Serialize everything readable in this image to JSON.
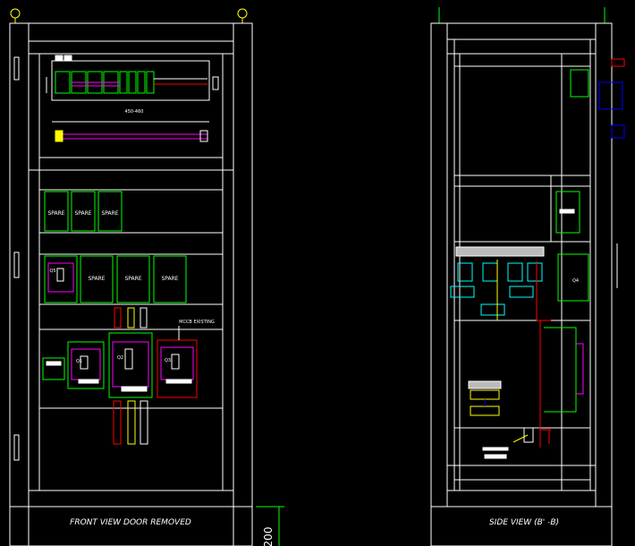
{
  "drawing": {
    "front_view_title": "FRONT VIEW DOOR REMOVED",
    "side_view_title": "SIDE VIEW (B' -B)",
    "dimension_label": "200",
    "spare_label": "SPARE",
    "small_breaker_labels": [
      "SPARE",
      "SPARE",
      "SPARE"
    ],
    "mid_breaker_labels": [
      "SPARE",
      "SPARE",
      "SPARE"
    ],
    "mccb_labels": [
      "Q1",
      "Q2",
      "Q3",
      "Q4",
      "Q5"
    ],
    "exist_label": "MCCB EXISTING",
    "busbar_label": "450-460",
    "colors": {
      "frame": "#ffffff",
      "breaker": "#00ff00",
      "accent": "#ff00ff",
      "phase_red": "#ff0000",
      "phase_yellow": "#ffff00",
      "neutral": "#00ffff",
      "earth": "#0000ff"
    }
  }
}
